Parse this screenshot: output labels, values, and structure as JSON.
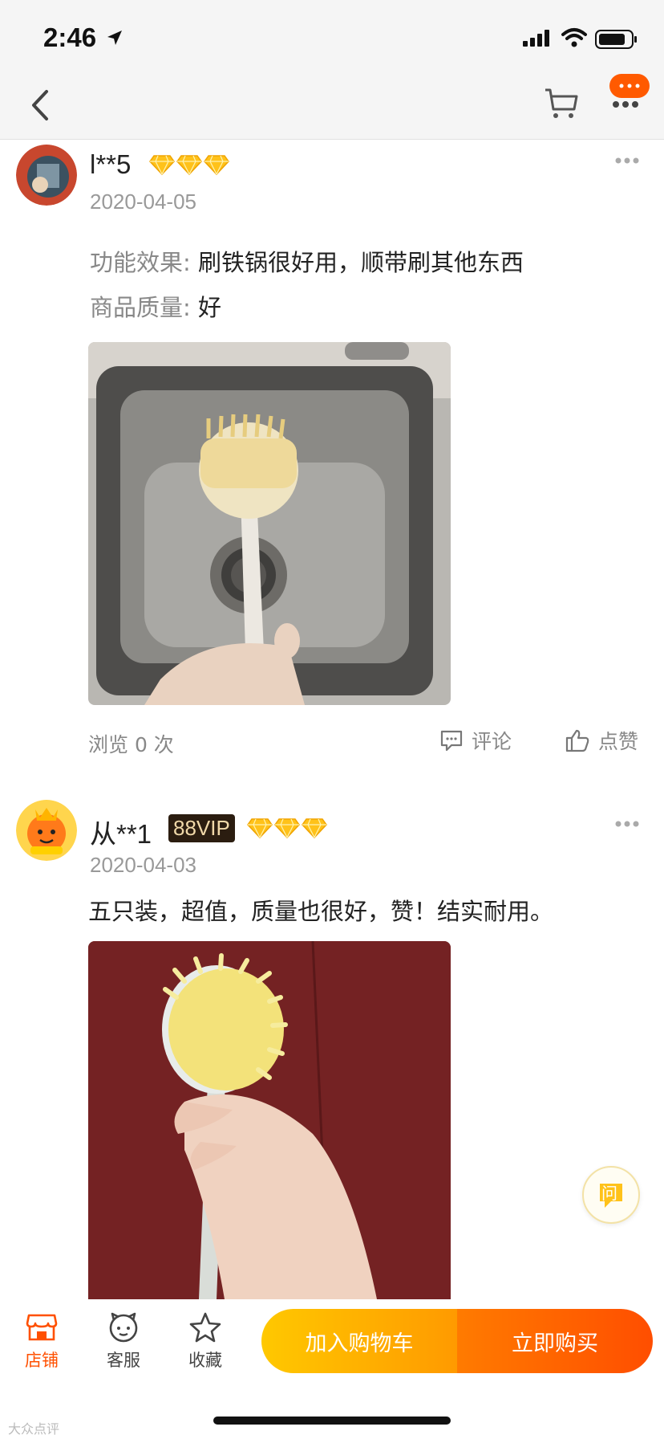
{
  "status": {
    "time": "2:46"
  },
  "nav": {
    "badge_text": "···"
  },
  "reviews": [
    {
      "username": "l**5",
      "gems": 3,
      "date": "2020-04-05",
      "lines": [
        {
          "label": "功能效果:",
          "text": "刷铁锅很好用，顺带刷其他东西"
        },
        {
          "label": "商品质量:",
          "text": "好"
        }
      ],
      "views_text": "浏览 0 次",
      "comment_label": "评论",
      "like_label": "点赞"
    },
    {
      "username": "从**1",
      "vip": "88VIP",
      "gems": 3,
      "date": "2020-04-03",
      "text": "五只装，超值，质量也很好，赞！结实耐用。"
    }
  ],
  "ask": {
    "label": "问"
  },
  "bottom": {
    "tabs": [
      {
        "label": "店铺",
        "icon": "store-icon"
      },
      {
        "label": "客服",
        "icon": "customer-service-icon"
      },
      {
        "label": "收藏",
        "icon": "star-icon"
      }
    ],
    "add_to_cart": "加入购物车",
    "buy_now": "立即购买",
    "watermark": "大众点评"
  },
  "colors": {
    "accent": "#ff5000",
    "cta_start": "#ffc800",
    "cta_end": "#ff4e00"
  }
}
